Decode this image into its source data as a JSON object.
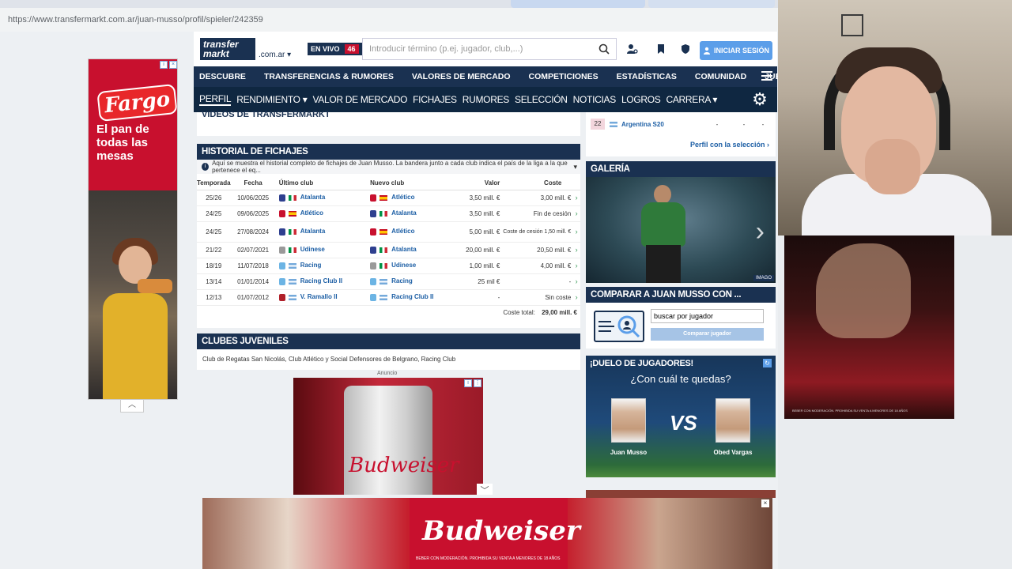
{
  "browser": {
    "url": "https://www.transfermarkt.com.ar/juan-musso/profil/spieler/242359"
  },
  "left_ad": {
    "brand": "Fargo",
    "tagline": "El pan de todas las mesas"
  },
  "header": {
    "logo_top": "transfer",
    "logo_bottom": "markt",
    "domain": ".com.ar ▾",
    "live_label": "EN VIVO",
    "live_count": "46",
    "search_placeholder": "Introducir término (p.ej. jugador, club,...)",
    "login_label": "INICIAR SESIÓN"
  },
  "main_nav": [
    "DESCUBRE",
    "TRANSFERENCIAS & RUMORES",
    "VALORES DE MERCADO",
    "COMPETICIONES",
    "ESTADÍSTICAS",
    "COMUNIDAD",
    "JUEGOS"
  ],
  "sub_nav": [
    "PERFIL",
    "RENDIMIENTO ▾",
    "VALOR DE MERCADO",
    "FICHAJES",
    "RUMORES",
    "SELECCIÓN",
    "NOTICIAS",
    "LOGROS",
    "CARRERA ▾"
  ],
  "videos_title": "VIDEOS DE TRANSFERMARKT",
  "history": {
    "title": "HISTORIAL DE FICHAJES",
    "info": "Aquí se muestra el historial completo de fichajes de Juan Musso. La bandera junto a cada club indica el país de la liga a la que pertenece el eq...",
    "headers": {
      "season": "Temporada",
      "date": "Fecha",
      "from": "Último club",
      "to": "Nuevo club",
      "value": "Valor",
      "fee": "Coste"
    },
    "rows": [
      {
        "season": "25/26",
        "date": "10/06/2025",
        "from": "Atalanta",
        "to": "Atlético",
        "value": "3,50 mill. €",
        "fee": "3,00 mill. €",
        "from_crest": "#2e3f8f",
        "to_crest": "#c8102e",
        "from_flag": "it",
        "to_flag": "es"
      },
      {
        "season": "24/25",
        "date": "09/06/2025",
        "from": "Atlético",
        "to": "Atalanta",
        "value": "3,50 mill. €",
        "fee": "Fin de cesión",
        "from_crest": "#c8102e",
        "to_crest": "#2e3f8f",
        "from_flag": "es",
        "to_flag": "it"
      },
      {
        "season": "24/25",
        "date": "27/08/2024",
        "from": "Atalanta",
        "to": "Atlético",
        "value": "5,00 mill. €",
        "fee": "Coste de cesión 1,50 mill. €",
        "from_crest": "#2e3f8f",
        "to_crest": "#c8102e",
        "from_flag": "it",
        "to_flag": "es"
      },
      {
        "season": "21/22",
        "date": "02/07/2021",
        "from": "Udinese",
        "to": "Atalanta",
        "value": "20,00 mill. €",
        "fee": "20,50 mill. €",
        "from_crest": "#9a9a9a",
        "to_crest": "#2e3f8f",
        "from_flag": "it",
        "to_flag": "it"
      },
      {
        "season": "18/19",
        "date": "11/07/2018",
        "from": "Racing",
        "to": "Udinese",
        "value": "1,00 mill. €",
        "fee": "4,00 mill. €",
        "from_crest": "#6cb4e4",
        "to_crest": "#9a9a9a",
        "from_flag": "ar",
        "to_flag": "it"
      },
      {
        "season": "13/14",
        "date": "01/01/2014",
        "from": "Racing Club II",
        "to": "Racing",
        "value": "25 mil €",
        "fee": "-",
        "from_crest": "#6cb4e4",
        "to_crest": "#6cb4e4",
        "from_flag": "ar",
        "to_flag": "ar"
      },
      {
        "season": "12/13",
        "date": "01/07/2012",
        "from": "V. Ramallo II",
        "to": "Racing Club II",
        "value": "-",
        "fee": "Sin coste",
        "from_crest": "#b0202a",
        "to_crest": "#6cb4e4",
        "from_flag": "ar",
        "to_flag": "ar"
      }
    ],
    "total_label": "Coste total:",
    "total_value": "29,00 mill. €"
  },
  "youth": {
    "title": "CLUBES JUVENILES",
    "text": "Club de Regatas San Nicolás, Club Atlético y Social Defensores de Belgrano, Racing Club"
  },
  "center_ad": {
    "label": "Anuncio",
    "brand": "Budweiser"
  },
  "ranking": {
    "num": "22",
    "team": "Argentina S20",
    "dash1": "-",
    "dash2": "-",
    "dash3": "-",
    "link": "Perfil con la selección"
  },
  "gallery": {
    "title": "GALERÍA",
    "tag": "IMAGO"
  },
  "compare": {
    "title": "COMPARAR A JUAN MUSSO CON ...",
    "input_value": "buscar por jugador",
    "button": "Comparar jugador"
  },
  "duel": {
    "title": "¡DUELO DE JUGADORES!",
    "question": "¿Con cuál te quedas?",
    "player1": "Juan Musso",
    "player2": "Obed Vargas",
    "vs": "VS"
  },
  "bottom_ad": {
    "brand": "Budweiser",
    "legal": "BEBER CON MODERACIÓN. PROHIBIDA SU VENTA A MENORES DE 18 AÑOS"
  },
  "colors": {
    "navy": "#1a3151",
    "link": "#1d5fa5",
    "login": "#5b9ee9"
  }
}
